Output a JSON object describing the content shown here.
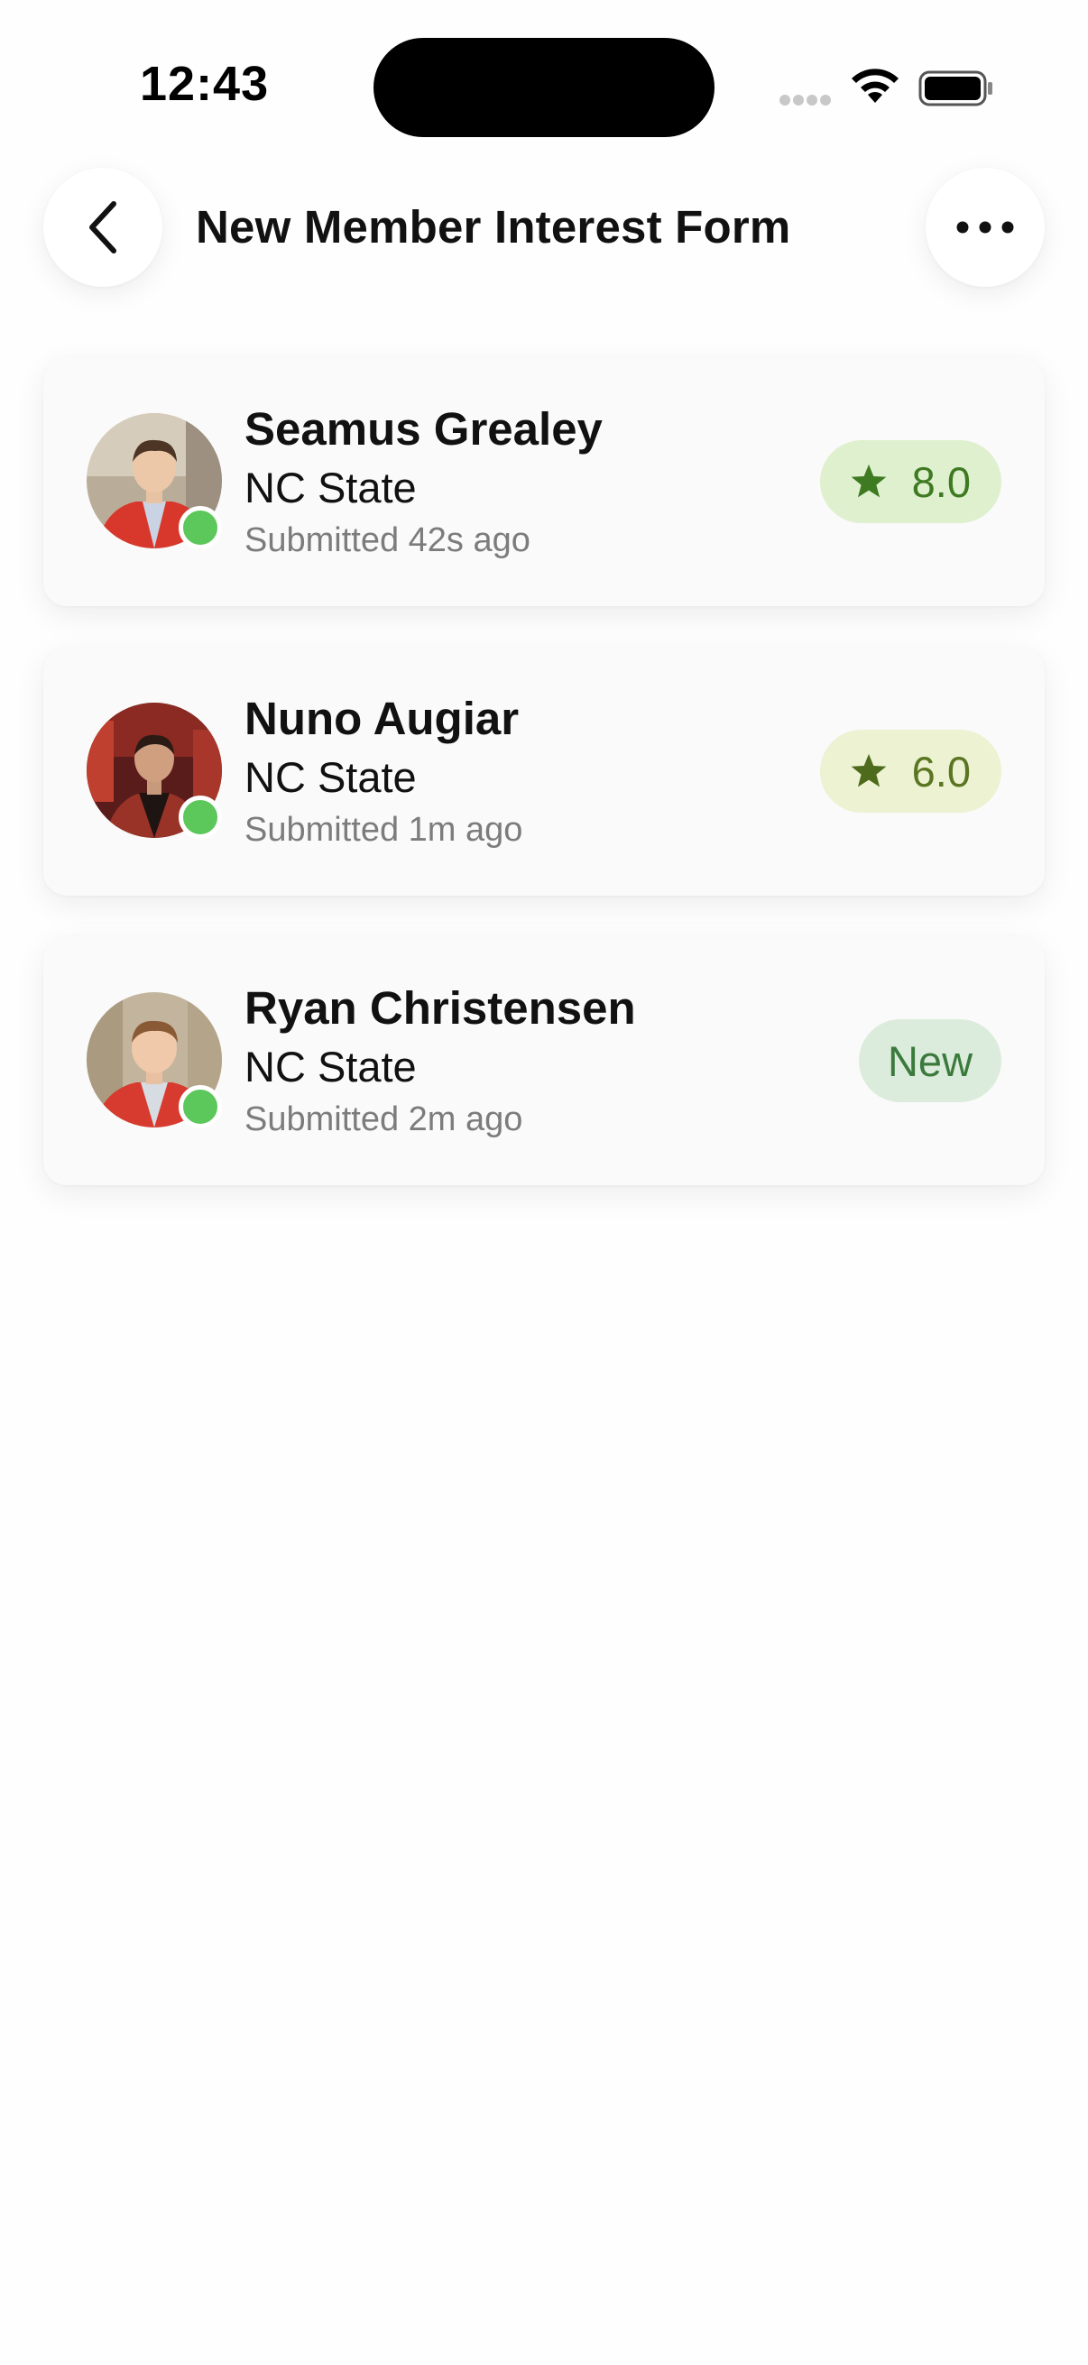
{
  "status_bar": {
    "time": "12:43"
  },
  "header": {
    "title": "New Member Interest Form",
    "back_icon": "chevron-left-icon",
    "more_icon": "ellipsis-icon"
  },
  "submissions": [
    {
      "name": "Seamus Grealey",
      "school": "NC State",
      "submitted": "Submitted 42s ago",
      "online": true,
      "badge": {
        "type": "score",
        "icon": "star-icon",
        "value": "8.0",
        "bg": "#dff0cf",
        "color": "#3e7a21"
      }
    },
    {
      "name": "Nuno Augiar",
      "school": "NC State",
      "submitted": "Submitted 1m ago",
      "online": true,
      "badge": {
        "type": "score",
        "icon": "star-icon",
        "value": "6.0",
        "bg": "#ecf2d2",
        "color": "#5b7622"
      }
    },
    {
      "name": "Ryan Christensen",
      "school": "NC State",
      "submitted": "Submitted 2m ago",
      "online": true,
      "badge": {
        "type": "new",
        "value": "New",
        "bg": "#dcecdc",
        "color": "#3b7a3d"
      }
    }
  ],
  "colors": {
    "presence": "#5cc75a",
    "background": "#fefefe",
    "card": "#fafafa"
  }
}
